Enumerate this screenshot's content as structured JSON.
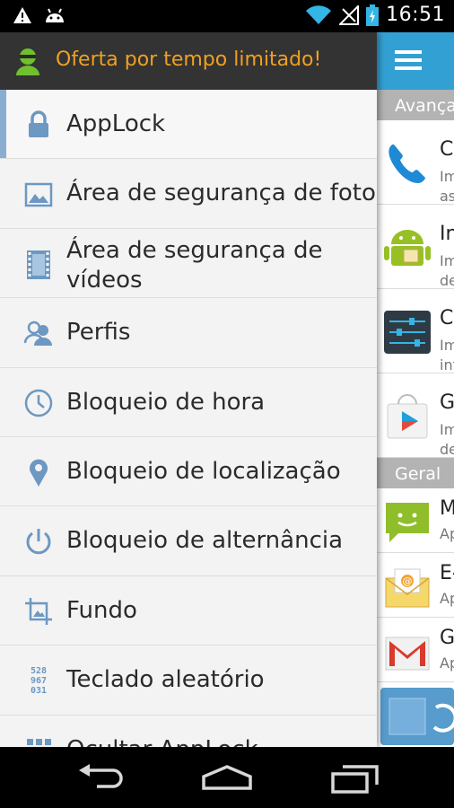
{
  "status_bar": {
    "time": "16:51",
    "icons": [
      "warning-icon",
      "android-icon",
      "wifi-icon",
      "signal-icon",
      "battery-charging-icon"
    ]
  },
  "drawer": {
    "promo": {
      "text": "Oferta por tempo limitado!",
      "icon": "avatar-icon",
      "color": "#f0a020"
    },
    "items": [
      {
        "label": "AppLock",
        "icon": "lock-icon",
        "active": true
      },
      {
        "label": "Área de segurança de fotos",
        "icon": "photo-icon"
      },
      {
        "label": "Área de segurança de vídeos",
        "icon": "film-icon"
      },
      {
        "label": "Perfis",
        "icon": "profiles-icon"
      },
      {
        "label": "Bloqueio de hora",
        "icon": "clock-icon"
      },
      {
        "label": "Bloqueio de localização",
        "icon": "location-pin-icon"
      },
      {
        "label": "Bloqueio de alternância",
        "icon": "power-icon"
      },
      {
        "label": "Fundo",
        "icon": "crop-icon"
      },
      {
        "label": "Teclado aleatório",
        "icon": "random-keypad-icon",
        "keypad_digits": [
          "528",
          "967",
          "031"
        ]
      },
      {
        "label": "Ocultar AppLock",
        "icon": "grid-icon"
      }
    ],
    "accent_color": "#8aaed1"
  },
  "background_app": {
    "accent_color": "#33a0d4",
    "sections": [
      {
        "title": "Avançado",
        "rows": [
          {
            "title": "Cl",
            "subtitle": [
              "Im",
              "as"
            ],
            "icon": "phone-icon"
          },
          {
            "title": "In",
            "subtitle": [
              "Im",
              "de"
            ],
            "icon": "android-installer-icon"
          },
          {
            "title": "Co",
            "subtitle": [
              "Im",
              "inf"
            ],
            "icon": "settings-sliders-icon"
          },
          {
            "title": "Go",
            "subtitle": [
              "Im",
              "de"
            ],
            "icon": "play-store-icon"
          }
        ]
      },
      {
        "title": "Geral",
        "rows": [
          {
            "title": "M",
            "subtitle": [
              "Ap"
            ],
            "icon": "messaging-icon"
          },
          {
            "title": "E-",
            "subtitle": [
              "Ap"
            ],
            "icon": "email-icon"
          },
          {
            "title": "G",
            "subtitle": [
              "Ap"
            ],
            "icon": "gmail-icon"
          }
        ]
      }
    ]
  },
  "nav_bar": {
    "buttons": [
      "back-icon",
      "home-icon",
      "recents-icon"
    ]
  }
}
